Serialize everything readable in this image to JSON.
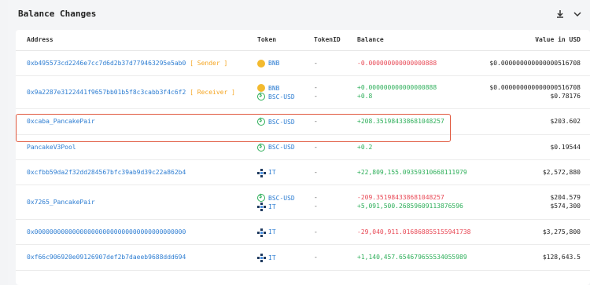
{
  "header": {
    "title": "Balance Changes"
  },
  "table": {
    "columns": {
      "address": "Address",
      "token": "Token",
      "tokenid": "TokenID",
      "balance": "Balance",
      "value": "Value in USD"
    },
    "rows": [
      {
        "address": "0xb495573cd2246e7cc7d6d2b37d779463295e5ab0",
        "role": "[ Sender ]",
        "entries": [
          {
            "token": "BNB",
            "icon": "bnb-icon",
            "tokenid": "-",
            "balance": "-0.000000000000000888",
            "sign": "neg",
            "value": "$0.000000000000000516708"
          }
        ]
      },
      {
        "address": "0x9a2287e3122441f9657bb01b5f8c3cabb3f4c6f2",
        "role": "[ Receiver ]",
        "entries": [
          {
            "token": "BNB",
            "icon": "bnb-icon",
            "tokenid": "-",
            "balance": "+0.000000000000000888",
            "sign": "pos",
            "value": "$0.000000000000000516708"
          },
          {
            "token": "BSC-USD",
            "icon": "bsc-usd-icon",
            "tokenid": "-",
            "balance": "+0.8",
            "sign": "pos",
            "value": "$0.78176"
          }
        ]
      },
      {
        "address": "0xcaba_PancakePair",
        "role": "",
        "entries": [
          {
            "token": "BSC-USD",
            "icon": "bsc-usd-icon",
            "tokenid": "-",
            "balance": "+208.351984338681048257",
            "sign": "pos",
            "value": "$203.602"
          }
        ]
      },
      {
        "address": "PancakeV3Pool",
        "role": "",
        "entries": [
          {
            "token": "BSC-USD",
            "icon": "bsc-usd-icon",
            "tokenid": "-",
            "balance": "+0.2",
            "sign": "pos",
            "value": "$0.19544"
          }
        ]
      },
      {
        "address": "0xcfbb59da2f32dd284567bfc39ab9d39c22a862b4",
        "role": "",
        "entries": [
          {
            "token": "IT",
            "icon": "it-token-icon",
            "tokenid": "-",
            "balance": "+22,809,155.09359310668111979",
            "sign": "pos",
            "value": "$2,572,880"
          }
        ]
      },
      {
        "address": "0x7265_PancakePair",
        "role": "",
        "entries": [
          {
            "token": "BSC-USD",
            "icon": "bsc-usd-icon",
            "tokenid": "-",
            "balance": "-209.351984338681048257",
            "sign": "neg",
            "value": "$204.579"
          },
          {
            "token": "IT",
            "icon": "it-token-icon",
            "tokenid": "-",
            "balance": "+5,091,500.26859609113876596",
            "sign": "pos",
            "value": "$574,300"
          }
        ]
      },
      {
        "address": "0x0000000000000000000000000000000000000000",
        "role": "",
        "entries": [
          {
            "token": "IT",
            "icon": "it-token-icon",
            "tokenid": "-",
            "balance": "-29,040,911.016868855155941738",
            "sign": "neg",
            "value": "$3,275,800"
          }
        ]
      },
      {
        "address": "0xf66c906920e09126907def2b7daeeb9688ddd694",
        "role": "",
        "entries": [
          {
            "token": "IT",
            "icon": "it-token-icon",
            "tokenid": "-",
            "balance": "+1,140,457.654679655534055989",
            "sign": "pos",
            "value": "$128,643.5"
          }
        ]
      }
    ]
  },
  "colors": {
    "link": "#2d7dd2",
    "positive": "#2eaf5a",
    "negative": "#e84855",
    "role": "#f5a623",
    "highlight": "#e0583e"
  }
}
